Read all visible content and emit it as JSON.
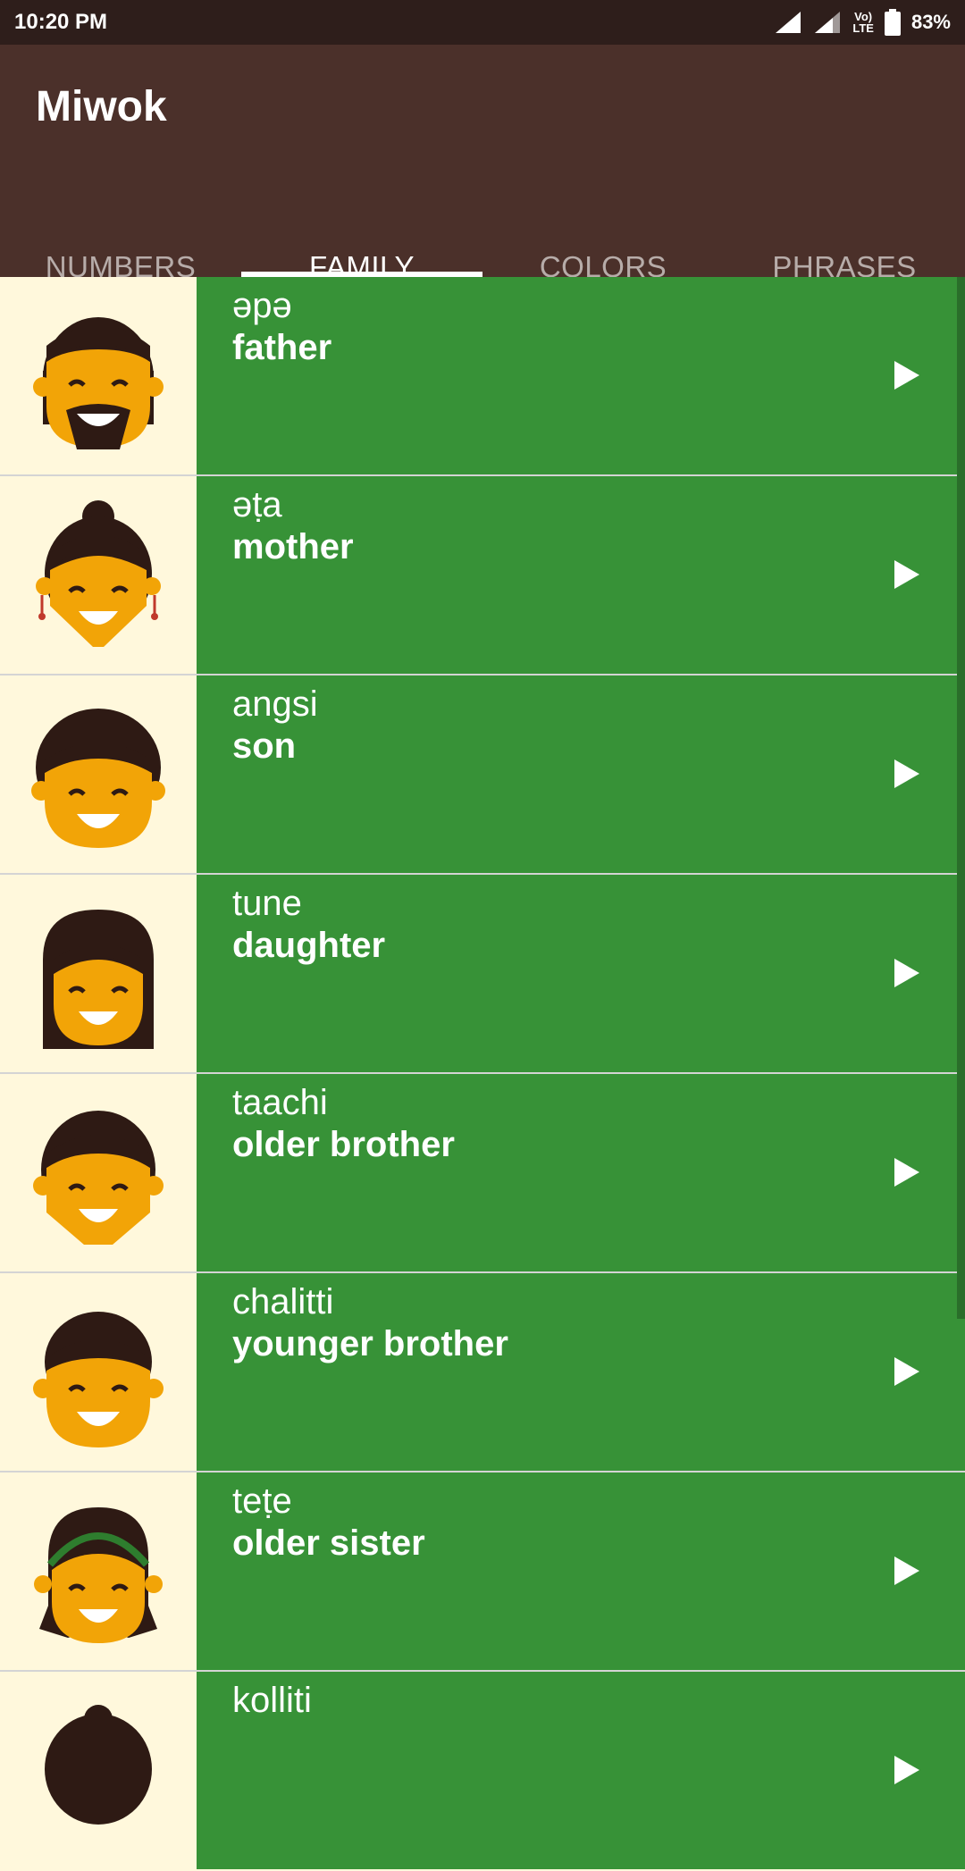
{
  "status_bar": {
    "time": "10:20 PM",
    "volte_line1": "Vo)",
    "volte_line2": "LTE",
    "battery": "83%",
    "icons": [
      "signal-icon",
      "signal-icon",
      "volte-icon",
      "battery-icon"
    ]
  },
  "app_bar": {
    "title": "Miwok",
    "tabs": [
      {
        "label": "NUMBERS",
        "active": false
      },
      {
        "label": "FAMILY",
        "active": true
      },
      {
        "label": "COLORS",
        "active": false
      },
      {
        "label": "PHRASES",
        "active": false
      }
    ]
  },
  "words": [
    {
      "miwok": "əpə",
      "english": "father",
      "icon": "father-avatar-icon"
    },
    {
      "miwok": "əṭa",
      "english": "mother",
      "icon": "mother-avatar-icon"
    },
    {
      "miwok": "angsi",
      "english": "son",
      "icon": "son-avatar-icon"
    },
    {
      "miwok": "tune",
      "english": "daughter",
      "icon": "daughter-avatar-icon"
    },
    {
      "miwok": "taachi",
      "english": "older brother",
      "icon": "older-brother-avatar-icon"
    },
    {
      "miwok": "chalitti",
      "english": "younger brother",
      "icon": "younger-brother-avatar-icon"
    },
    {
      "miwok": "teṭe",
      "english": "older sister",
      "icon": "older-sister-avatar-icon"
    },
    {
      "miwok": "kolliti",
      "english": "",
      "icon": "younger-sister-avatar-icon"
    }
  ],
  "colors": {
    "status_bar": "#2e1e1b",
    "app_bar": "#4b302a",
    "item_background": "#379237",
    "avatar_background": "#fff8dc",
    "skin": "#f2a407",
    "hair": "#2e1a14"
  }
}
